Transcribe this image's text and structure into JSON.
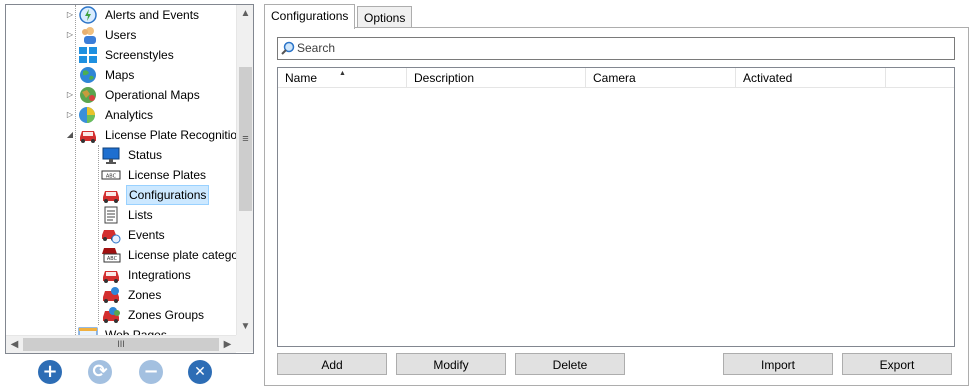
{
  "tree": {
    "items": [
      {
        "label": "Alerts and Events",
        "icon": "alert-clock-icon",
        "expander": "▷"
      },
      {
        "label": "Users",
        "icon": "users-icon",
        "expander": "▷"
      },
      {
        "label": "Screenstyles",
        "icon": "screenstyles-icon",
        "expander": ""
      },
      {
        "label": "Maps",
        "icon": "globe-icon",
        "expander": ""
      },
      {
        "label": "Operational Maps",
        "icon": "operational-map-icon",
        "expander": "▷"
      },
      {
        "label": "Analytics",
        "icon": "analytics-icon",
        "expander": "▷"
      },
      {
        "label": "License Plate Recognition",
        "icon": "car-icon",
        "expander": "◢"
      },
      {
        "label": "Status",
        "icon": "monitor-icon",
        "expander": ""
      },
      {
        "label": "License Plates",
        "icon": "license-plate-icon",
        "expander": ""
      },
      {
        "label": "Configurations",
        "icon": "car-icon",
        "expander": "",
        "selected": true
      },
      {
        "label": "Lists",
        "icon": "list-document-icon",
        "expander": ""
      },
      {
        "label": "Events",
        "icon": "car-events-icon",
        "expander": ""
      },
      {
        "label": "License plate categor",
        "icon": "plate-category-icon",
        "expander": ""
      },
      {
        "label": "Integrations",
        "icon": "car-icon",
        "expander": ""
      },
      {
        "label": "Zones",
        "icon": "car-zone-icon",
        "expander": ""
      },
      {
        "label": "Zones Groups",
        "icon": "car-zone-group-icon",
        "expander": ""
      },
      {
        "label": "Web Pages",
        "icon": "web-pages-icon",
        "expander": ""
      }
    ],
    "scroll_up": "▲",
    "scroll_down": "▼",
    "scroll_left": "◀",
    "scroll_right": "▶",
    "vgrip": "≡",
    "hgrip": "III"
  },
  "round_buttons": {
    "add": "+",
    "refresh": "⟳",
    "remove": "−",
    "delete": "✕"
  },
  "tabs": [
    {
      "label": "Configurations",
      "active": true
    },
    {
      "label": "Options",
      "active": false
    }
  ],
  "search": {
    "placeholder": "Search",
    "value": ""
  },
  "table": {
    "columns": [
      "Name",
      "Description",
      "Camera",
      "Activated"
    ],
    "sort_indicator": "▲",
    "rows": []
  },
  "actions": {
    "add": "Add",
    "modify": "Modify",
    "delete": "Delete",
    "import": "Import",
    "export": "Export"
  },
  "colors": {
    "selection_bg": "#cce8ff",
    "round_button": "#2d6db5",
    "round_button_disabled": "#a3c0e0"
  }
}
